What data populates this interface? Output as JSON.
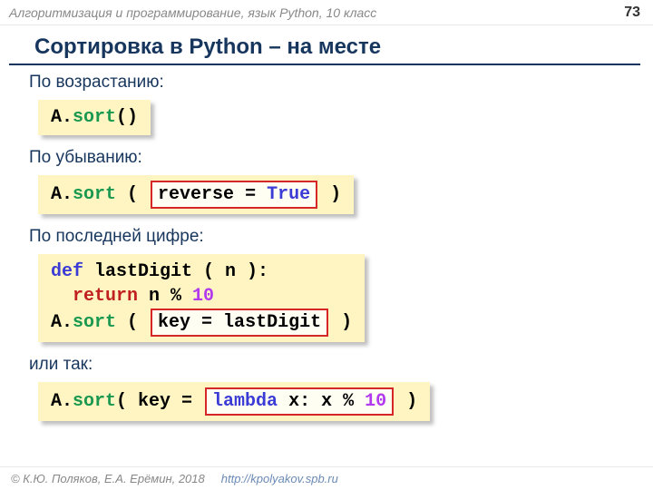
{
  "header": {
    "course": "Алгоритмизация и программирование, язык Python, 10 класс",
    "page": "73"
  },
  "title": "Сортировка в Python – на месте",
  "sections": {
    "asc": {
      "label": "По возрастанию:",
      "code": {
        "a": "A.",
        "sort": "sort",
        "rest": "()"
      }
    },
    "desc": {
      "label": "По убыванию:",
      "code": {
        "a": "A.",
        "sort": "sort",
        "open": " ( ",
        "box_l": "reverse = ",
        "box_true": "True",
        "close": " )"
      }
    },
    "last": {
      "label": "По последней цифре:",
      "code": {
        "def": "def",
        "sig": " lastDigit ( n ):",
        "ret": "return",
        "retexpr_pre": " n % ",
        "retexpr_ten": "10",
        "a": "A.",
        "sort": "sort",
        "open": " ( ",
        "box": "key = lastDigit",
        "close": " )"
      }
    },
    "alt": {
      "label": "или так:",
      "code": {
        "a": "A.",
        "sort": "sort",
        "open": "( key = ",
        "box_l": "lambda",
        "box_mid": " x: x % ",
        "box_ten": "10",
        "close": " )"
      }
    }
  },
  "footer": {
    "copyright": "© К.Ю. Поляков, Е.А. Ерёмин, 2018",
    "url": "http://kpolyakov.spb.ru"
  }
}
